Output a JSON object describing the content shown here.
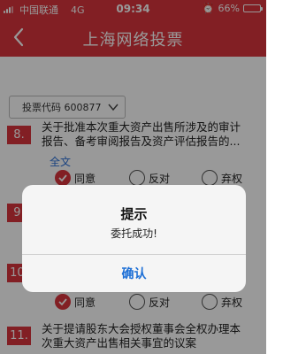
{
  "status_bar": {
    "carrier": "中国联通",
    "network": "4G",
    "time": "09:34",
    "battery_percent": "66%",
    "battery_level": 0.66
  },
  "nav": {
    "title": "上海网络投票"
  },
  "code_select": {
    "label": "投票代码 600877"
  },
  "items": [
    {
      "number": "8.",
      "line1": "关于批准本次重大资产出售所涉及的审计",
      "line2": "报告、备考审阅报告及资产评估报告的...",
      "fulltext": "全文"
    },
    {
      "number": "9.",
      "line1": "",
      "line2": ""
    },
    {
      "number": "10.",
      "line1": "",
      "line2": ""
    },
    {
      "number": "11.",
      "line1": "关于提请股东大会授权董事会全权办理本",
      "line2": "次重大资产出售相关事宜的议案"
    }
  ],
  "vote_options": {
    "agree": "同意",
    "oppose": "反对",
    "abstain": "弃权"
  },
  "dialog": {
    "title": "提示",
    "message": "委托成功!",
    "confirm": "确认"
  },
  "colors": {
    "brand_red": "#d9353c",
    "link_blue": "#2a6fd6"
  }
}
